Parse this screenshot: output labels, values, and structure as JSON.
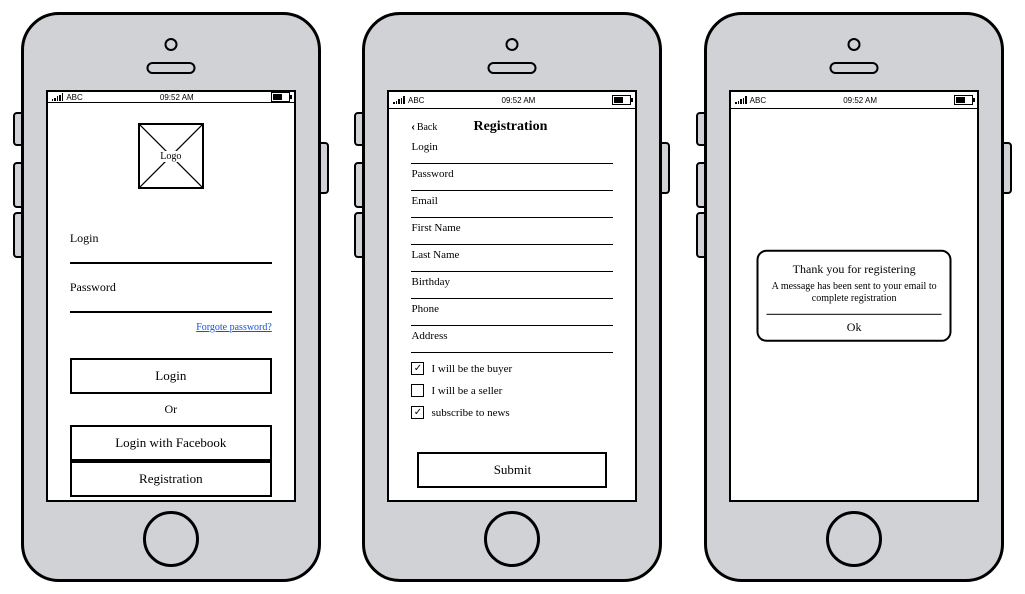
{
  "statusbar": {
    "carrier": "ABC",
    "time": "09:52 AM"
  },
  "screen1": {
    "logo": "Logo",
    "login_label": "Login",
    "password_label": "Password",
    "forgot": "Forgote password?",
    "login_btn": "Login",
    "or": "Or",
    "fb_btn": "Login with Facebook",
    "reg_btn": "Registration"
  },
  "screen2": {
    "back": "Back",
    "title": "Registration",
    "fields": {
      "login": "Login",
      "password": "Password",
      "email": "Email",
      "first_name": "First Name",
      "last_name": "Last Name",
      "birthday": "Birthday",
      "phone": "Phone",
      "address": "Address"
    },
    "chk_buyer": "I will be the buyer",
    "chk_seller": "I will be a seller",
    "chk_news": "subscribe to news",
    "chk_buyer_checked": true,
    "chk_seller_checked": false,
    "chk_news_checked": true,
    "submit": "Submit"
  },
  "screen3": {
    "title": "Thank you for registering",
    "body": "A message has been sent to your email to complete registration",
    "ok": "Ok"
  }
}
